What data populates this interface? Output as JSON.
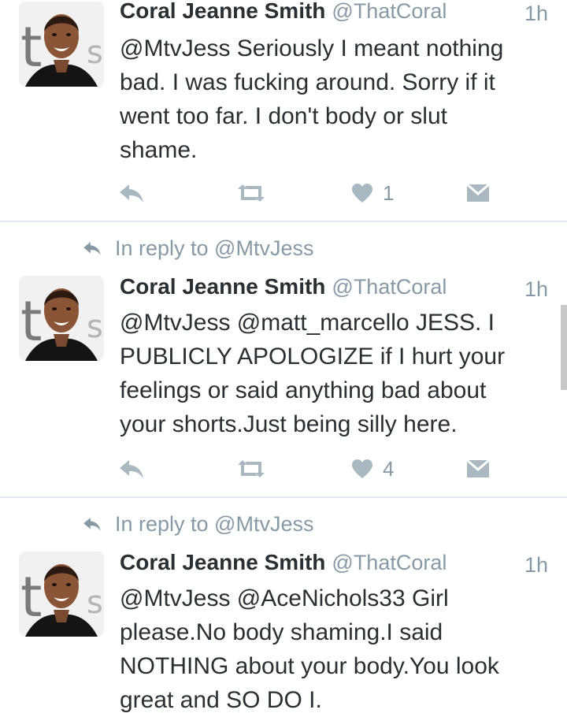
{
  "tweets": [
    {
      "author_name": "Coral Jeanne Smith",
      "handle": "@ThatCoral",
      "time": "1h",
      "reply_context": "",
      "lines": [
        "@MtvJess Seriously I meant nothing",
        "bad. I was fucking around. Sorry if it",
        "went too far. I don't body or slut",
        "shame."
      ],
      "like_count": "1"
    },
    {
      "author_name": "Coral Jeanne Smith",
      "handle": "@ThatCoral",
      "time": "1h",
      "reply_context": "In reply to @MtvJess",
      "lines": [
        "@MtvJess @matt_marcello JESS. I",
        "PUBLICLY APOLOGIZE if I hurt your",
        "feelings or said anything bad about",
        "your shorts.Just being silly here."
      ],
      "like_count": "4"
    },
    {
      "author_name": "Coral Jeanne Smith",
      "handle": "@ThatCoral",
      "time": "1h",
      "reply_context": "In reply to @MtvJess",
      "lines": [
        "@MtvJess @AceNichols33 Girl",
        "please.No body shaming.I said",
        "NOTHING about your body.You look",
        "great and SO DO I."
      ],
      "like_count": ""
    }
  ],
  "icons": {
    "reply": "reply-arrow-icon",
    "retweet": "retweet-icon",
    "like": "heart-icon",
    "dm": "envelope-icon"
  },
  "colors": {
    "text": "#292f33",
    "muted": "#8899a6",
    "action_icon": "#aab8c2",
    "divider": "#e1e8ed"
  }
}
